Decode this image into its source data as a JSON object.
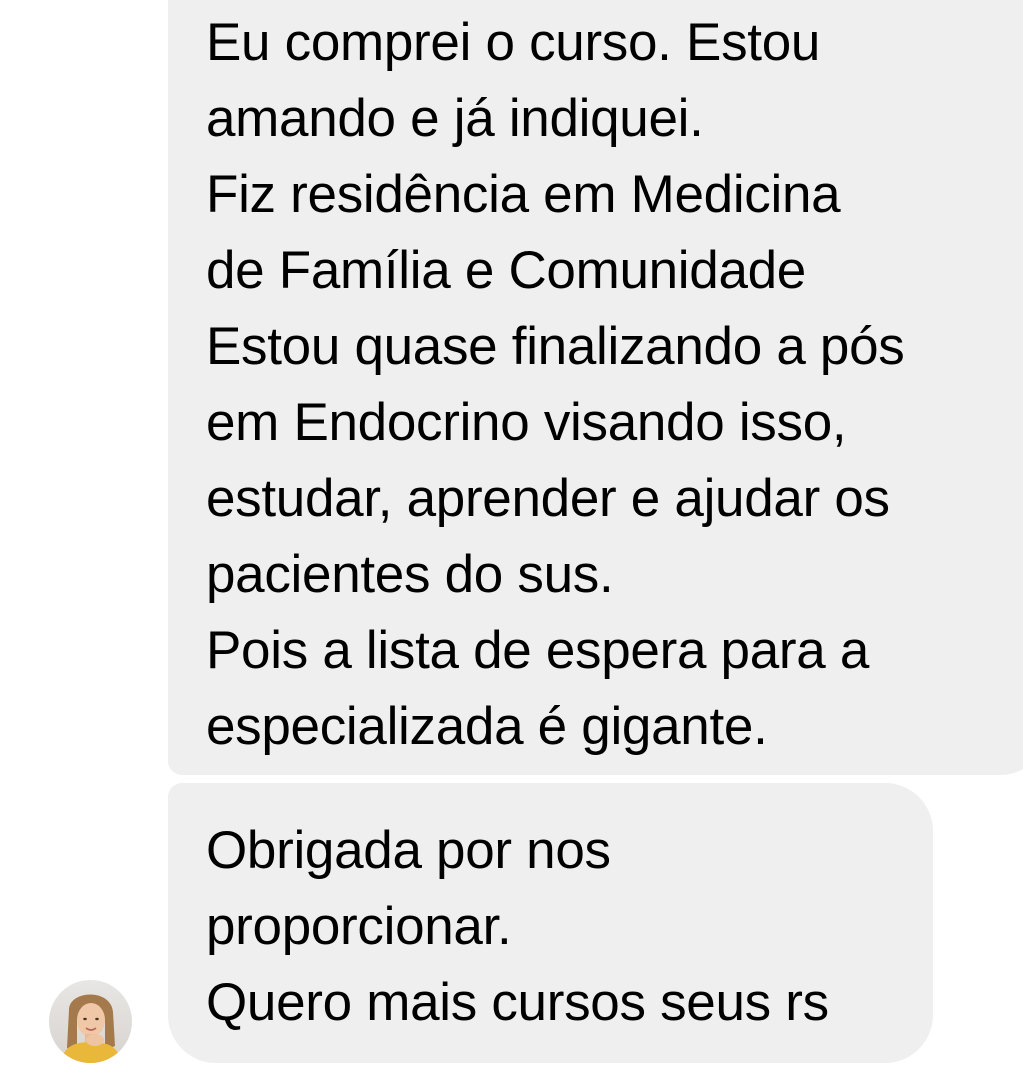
{
  "conversation": {
    "messages": [
      {
        "lines": [
          "Eu comprei o curso. Estou",
          "amando e já indiquei.",
          "Fiz residência em Medicina",
          "de Família e Comunidade",
          "Estou quase finalizando a pós",
          "em Endocrino visando isso,",
          "estudar, aprender e ajudar os",
          "pacientes do sus.",
          "Pois a lista de espera para a",
          "especializada é gigante."
        ]
      },
      {
        "lines": [
          "Obrigada por nos",
          "proporcionar.",
          "Quero mais cursos seus rs"
        ]
      }
    ]
  },
  "colors": {
    "bubble_background": "#efefef",
    "text": "#000000",
    "page_background": "#ffffff"
  }
}
